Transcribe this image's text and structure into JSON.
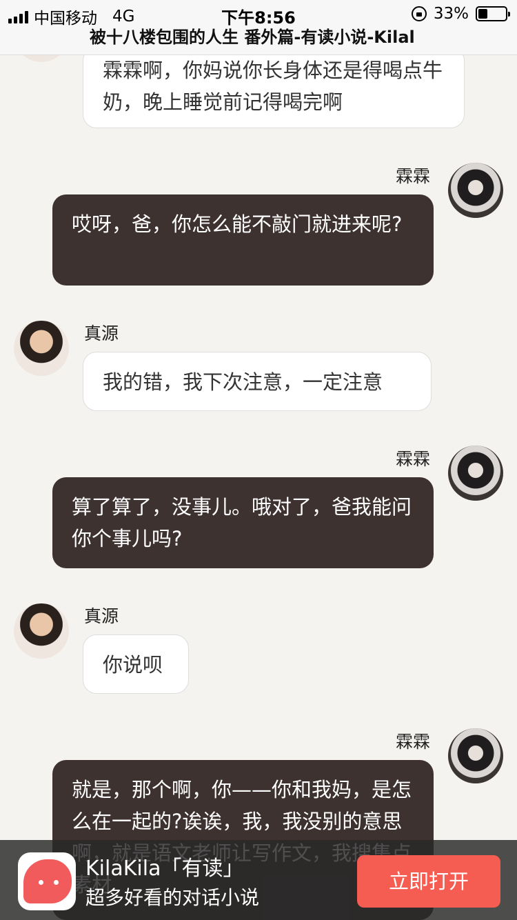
{
  "status": {
    "carrier": "中国移动",
    "network": "4G",
    "time": "下午8:56",
    "battery": "33%",
    "battery_level": 0.33
  },
  "header": {
    "title": "被十八楼包围的人生 番外篇-有读小说-Kilal"
  },
  "messages": [
    {
      "side": "left",
      "sender": "",
      "text": "霖霖啊，你妈说你长身体还是得喝点牛奶，晚上睡觉前记得喝完啊"
    },
    {
      "side": "right",
      "sender": "霖霖",
      "text": "哎呀，爸，你怎么能不敲门就进来呢?"
    },
    {
      "side": "left",
      "sender": "真源",
      "text": "我的错，我下次注意，一定注意"
    },
    {
      "side": "right",
      "sender": "霖霖",
      "text": "算了算了，没事儿。哦对了，爸我能问你个事儿吗?"
    },
    {
      "side": "left",
      "sender": "真源",
      "text": "你说呗"
    },
    {
      "side": "right",
      "sender": "霖霖",
      "text": "就是，那个啊，你——你和我妈，是怎么在一起的?诶诶，我，我没别的意思啊，就是语文老师让写作文，我搜集点素材"
    }
  ],
  "banner": {
    "app_name": "KilaKila「有读」",
    "slogan": "超多好看的对话小说",
    "open_label": "立即打开"
  }
}
